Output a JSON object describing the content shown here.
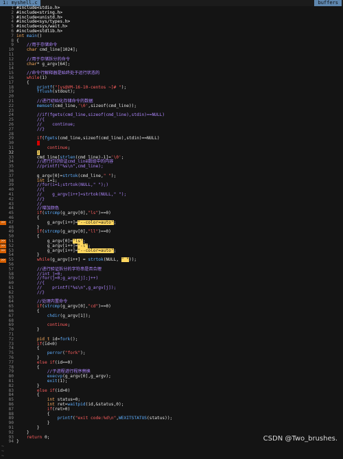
{
  "tabs": {
    "active_label": "1: myshell.c",
    "buffers_label": "buffers"
  },
  "editor": {
    "current_line": 32,
    "lines": [
      {
        "n": "1",
        "code": "#include<stdio.h>"
      },
      {
        "n": "2",
        "code": "#include<string.h>"
      },
      {
        "n": "3",
        "code": "#include<unistd.h>"
      },
      {
        "n": "4",
        "code": "#include<sys/types.h>"
      },
      {
        "n": "5",
        "code": "#include<sys/wait.h>"
      },
      {
        "n": "6",
        "code": "#include<stdlib.h>"
      },
      {
        "n": "7",
        "code": "int main()"
      },
      {
        "n": "8",
        "code": "{"
      },
      {
        "n": "9",
        "code": "    //用于存储命令"
      },
      {
        "n": "10",
        "code": "    char cmd_line[1024];"
      },
      {
        "n": "11",
        "code": ""
      },
      {
        "n": "12",
        "code": "    //用于存储拆分的命令"
      },
      {
        "n": "13",
        "code": "    char* g_argv[64];"
      },
      {
        "n": "14",
        "code": ""
      },
      {
        "n": "15",
        "code": "    //命令行解释器是始终处于运行状态的"
      },
      {
        "n": "16",
        "code": "    while(1)"
      },
      {
        "n": "17",
        "code": "    {"
      },
      {
        "n": "18",
        "code": "        printf(\"[ys@VM-16-10-centos ~]# \");"
      },
      {
        "n": "19",
        "code": "        fflush(stdout);"
      },
      {
        "n": "20",
        "code": ""
      },
      {
        "n": "21",
        "code": "        //进行初始化存储命令的数据"
      },
      {
        "n": "22",
        "code": "        memset(cmd_line,'\\0',sizeof(cmd_line));"
      },
      {
        "n": "23",
        "code": ""
      },
      {
        "n": "24",
        "code": "        //if(fgets(cmd_line,sizeof(cmd_line),stdin)==NULL)"
      },
      {
        "n": "25",
        "code": "        //{"
      },
      {
        "n": "26",
        "code": "        //    continue;"
      },
      {
        "n": "27",
        "code": "        //}"
      },
      {
        "n": "28",
        "code": ""
      },
      {
        "n": "29",
        "code": "        if(fgets(cmd_line,sizeof(cmd_line),stdin)==NULL)"
      },
      {
        "n": "30",
        "code": "        {"
      },
      {
        "n": "31",
        "code": "            continue;"
      },
      {
        "n": "32",
        "code": "        }"
      },
      {
        "n": "33",
        "code": "        cmd_line[strlen(cmd_line)-1]='\\0';"
      },
      {
        "n": "34",
        "code": "        //进行打印验证cmd_line数组中的内容"
      },
      {
        "n": "35",
        "code": "        //printf(\"%s\\n\",cmd_line);"
      },
      {
        "n": "36",
        "code": ""
      },
      {
        "n": "37",
        "code": "        g_argv[0]=strtok(cmd_line,\" \");"
      },
      {
        "n": "38",
        "code": "        int i=1;"
      },
      {
        "n": "39",
        "code": "        //for(i=1;strtok(NULL,\" \");)"
      },
      {
        "n": "40",
        "code": "        //{"
      },
      {
        "n": "41",
        "code": "        //    g_argv[i++]=strtok(NULL,\" \");"
      },
      {
        "n": "42",
        "code": "        //}"
      },
      {
        "n": "43",
        "code": "        //"
      },
      {
        "n": "44",
        "code": "        //增加颜色"
      },
      {
        "n": "45",
        "code": "        if(strcmp(g_argv[0],\"ls\")==0)"
      },
      {
        "n": "46",
        "code": "        {"
      },
      {
        "n": "47",
        "code": "            g_argv[i++]=\"--color=auto\";"
      },
      {
        "n": "48",
        "code": "        }"
      },
      {
        "n": "49",
        "code": "        if(strcmp(g_argv[0],\"ll\")==0)"
      },
      {
        "n": "50",
        "code": "        {"
      },
      {
        "n": "51",
        "code": "            g_argv[0]=\"ls\";"
      },
      {
        "n": "52",
        "code": "            g_argv[i++]=\"-l\";"
      },
      {
        "n": "53",
        "code": "            g_argv[i++]=\"--color=auto\";"
      },
      {
        "n": "54",
        "code": "        }"
      },
      {
        "n": "55",
        "code": "        while(g_argv[i++] = strtok(NULL, \" \"));"
      },
      {
        "n": "56",
        "code": ""
      },
      {
        "n": "57",
        "code": "        //进行验证拆分的字符串是否合理"
      },
      {
        "n": "58",
        "code": "        //int j=0;"
      },
      {
        "n": "59",
        "code": "        //for(j=0;g_argv[j];j++)"
      },
      {
        "n": "60",
        "code": "        //{"
      },
      {
        "n": "61",
        "code": "        //    printf(\"%s\\n\",g_argv[j]);"
      },
      {
        "n": "62",
        "code": "        //}"
      },
      {
        "n": "63",
        "code": ""
      },
      {
        "n": "64",
        "code": "        //处理内置命令"
      },
      {
        "n": "65",
        "code": "        if(strcmp(g_argv[0],\"cd\")==0)"
      },
      {
        "n": "66",
        "code": "        {"
      },
      {
        "n": "67",
        "code": "            chdir(g_argv[1]);"
      },
      {
        "n": "68",
        "code": ""
      },
      {
        "n": "69",
        "code": "            continue;"
      },
      {
        "n": "70",
        "code": "        }"
      },
      {
        "n": "71",
        "code": ""
      },
      {
        "n": "72",
        "code": "        pid_t id=fork();"
      },
      {
        "n": "73",
        "code": "        if(id<0)"
      },
      {
        "n": "74",
        "code": "        {"
      },
      {
        "n": "75",
        "code": "            perror(\"fork\");"
      },
      {
        "n": "76",
        "code": "        }"
      },
      {
        "n": "77",
        "code": "        else if(id==0)"
      },
      {
        "n": "78",
        "code": "        {"
      },
      {
        "n": "79",
        "code": "            //子进程进行程序替换"
      },
      {
        "n": "80",
        "code": "            execvp(g_argv[0],g_argv);"
      },
      {
        "n": "81",
        "code": "            exit(1);"
      },
      {
        "n": "82",
        "code": "        }"
      },
      {
        "n": "83",
        "code": "        else if(id>0)"
      },
      {
        "n": "84",
        "code": "        {"
      },
      {
        "n": "85",
        "code": "            int status=0;"
      },
      {
        "n": "86",
        "code": "            int ret=waitpid(id,&status,0);"
      },
      {
        "n": "87",
        "code": "            if(ret>0)"
      },
      {
        "n": "88",
        "code": "            {"
      },
      {
        "n": "89",
        "code": "                printf(\"exit code:%d\\n\",WEXITSTATUS(status));"
      },
      {
        "n": "90",
        "code": "            }"
      },
      {
        "n": "91",
        "code": "        }"
      },
      {
        "n": "92",
        "code": "    }"
      },
      {
        "n": "93",
        "code": "    return 0;"
      },
      {
        "n": "94",
        "code": "}"
      }
    ],
    "warning_sign": ">>",
    "warning_lines": [
      "47",
      "51",
      "52",
      "53",
      "55"
    ],
    "highlights": {
      "47": [
        "\"--color=auto\""
      ],
      "51": [
        "\"ls\""
      ],
      "52": [
        "\"-l\""
      ],
      "53": [
        "\"--color=auto\""
      ],
      "55": [
        "\" \""
      ]
    },
    "tilde": "~"
  },
  "watermark": "CSDN @Two_brushes."
}
